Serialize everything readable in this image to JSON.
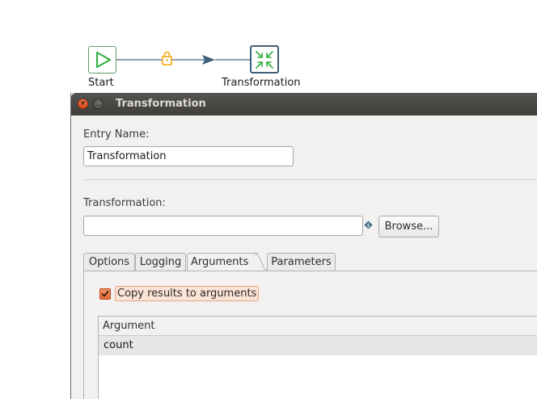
{
  "canvas": {
    "start_node": {
      "label": "Start",
      "icon": "play-icon",
      "border_color": "#5b9b6a"
    },
    "transformation_node": {
      "label": "Transformation",
      "icon": "compress-arrows-icon",
      "border_color": "#3f5e79"
    },
    "hop": {
      "icon": "lock-icon",
      "lock_color": "#f0a400",
      "arrow_color": "#3f5e79"
    }
  },
  "dialog": {
    "title": "Transformation",
    "titlebar_buttons": {
      "close": "×",
      "maximize": "□"
    },
    "entry_name": {
      "label": "Entry Name:",
      "value": "Transformation"
    },
    "transformation_field": {
      "label": "Transformation:",
      "value": "",
      "variable_icon": "variable-diamond-icon"
    },
    "browse_button": {
      "label": "Browse..."
    },
    "tabs": [
      {
        "label": "Options",
        "active": false
      },
      {
        "label": "Logging",
        "active": false
      },
      {
        "label": "Arguments",
        "active": true
      },
      {
        "label": "Parameters",
        "active": false
      }
    ],
    "copy_results": {
      "label": "Copy results to arguments",
      "checked": true,
      "accent": "#e56c37"
    },
    "arguments_table": {
      "columns": [
        "Argument"
      ],
      "rows": [
        [
          "count"
        ]
      ]
    }
  }
}
